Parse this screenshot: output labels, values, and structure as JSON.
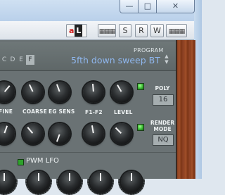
{
  "window": {
    "min_glyph": "—",
    "max_glyph": "□",
    "close_glyph": "✕"
  },
  "toolbar": {
    "al_a": "a",
    "al_l": "L",
    "btn_s": "S",
    "btn_r": "R",
    "btn_w": "W",
    "keyboard_glyph": "▦▦▦"
  },
  "tabs": [
    "C",
    "D",
    "E",
    "F"
  ],
  "selected_tab": "F",
  "program": {
    "label": "PROGRAM",
    "name": "5fth down sweep BT",
    "up": "▲",
    "down": "▼"
  },
  "row1_labels": {
    "fine": "FINE",
    "coarse": "COARSE",
    "eg_sens": "EG SENS",
    "f1f2": "F1-F2",
    "level": "LEVEL"
  },
  "poly": {
    "label": "POLY",
    "value": "16"
  },
  "render_mode": {
    "label_line1": "RENDER",
    "label_line2": "MODE",
    "value": "NQ"
  },
  "pwm": {
    "label": "PWM LFO"
  },
  "colors": {
    "accent_program": "#8fb7ee",
    "led_green": "#2fae2a"
  }
}
